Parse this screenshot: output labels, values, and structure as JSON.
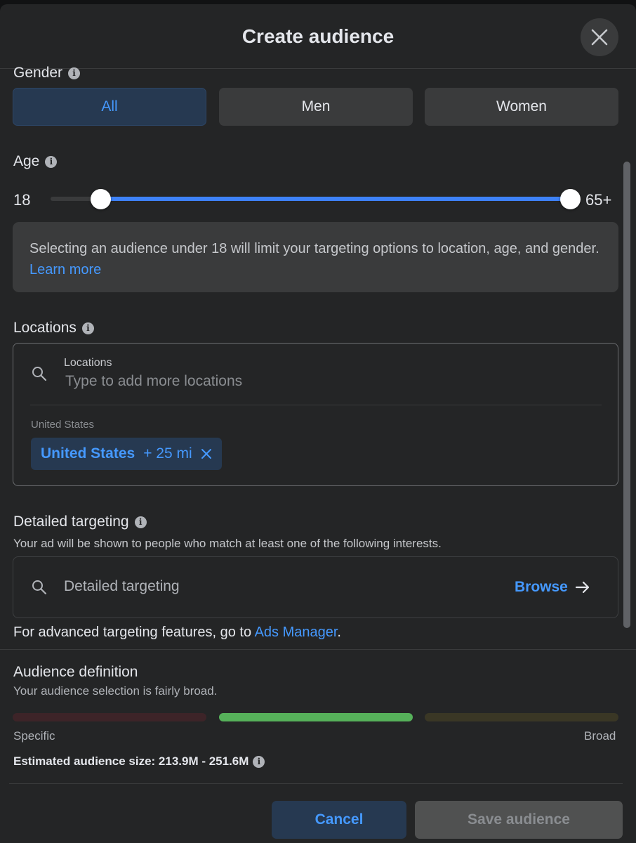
{
  "modal": {
    "title": "Create audience"
  },
  "gender": {
    "label": "Gender",
    "options": [
      "All",
      "Men",
      "Women"
    ],
    "selected": "All"
  },
  "age": {
    "label": "Age",
    "min_label": "18",
    "max_label": "65+",
    "range_min": 13,
    "range_max": 65,
    "selected_min": 18,
    "selected_max": 65
  },
  "notice": {
    "text": "Selecting an audience under 18 will limit your targeting options to location, age, and gender.",
    "link": "Learn more"
  },
  "locations": {
    "label": "Locations",
    "field_label": "Locations",
    "placeholder": "Type to add more locations",
    "group": "United States",
    "chip": {
      "name": "United States",
      "radius": "+ 25 mi"
    }
  },
  "detailed": {
    "label": "Detailed targeting",
    "subtitle": "Your ad will be shown to people who match at least one of the following interests.",
    "placeholder": "Detailed targeting",
    "browse": "Browse"
  },
  "advanced": {
    "text": "For advanced targeting features, go to ",
    "link": "Ads Manager",
    "suffix": "."
  },
  "definition": {
    "title": "Audience definition",
    "subtitle": "Your audience selection is fairly broad.",
    "specific_label": "Specific",
    "broad_label": "Broad",
    "level": "fairly broad",
    "colors": {
      "specific": "#3d2428",
      "middle": "#56b15a",
      "broad": "#3a3725"
    },
    "estimate": "Estimated audience size: 213.9M - 251.6M"
  },
  "footer": {
    "cancel": "Cancel",
    "save": "Save audience"
  }
}
